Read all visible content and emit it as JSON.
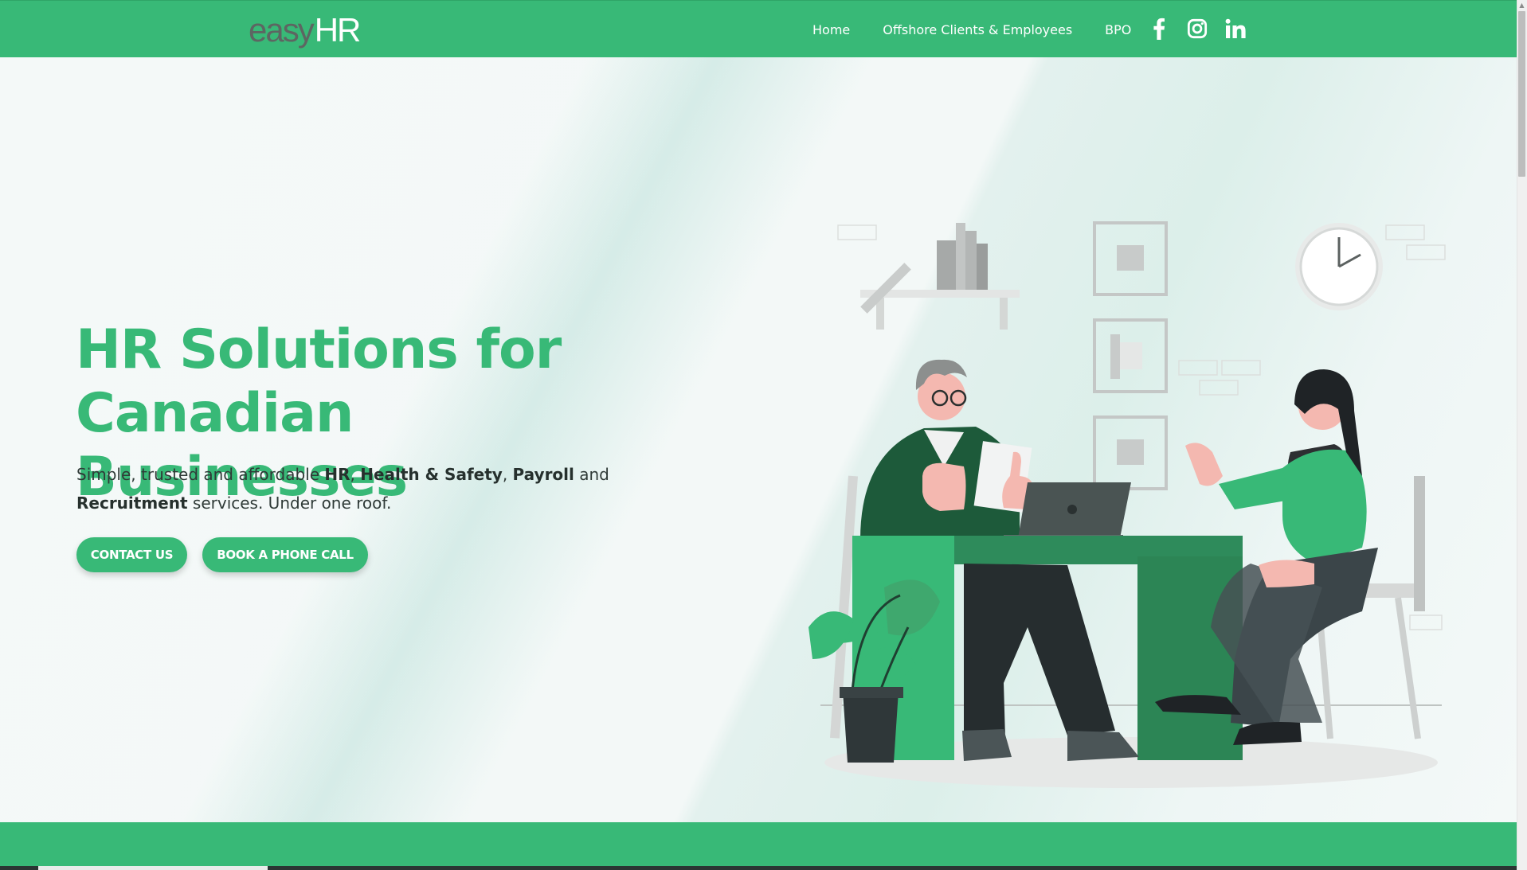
{
  "header": {
    "logo": {
      "part1": "easy",
      "part2": "HR"
    },
    "nav": [
      {
        "label": "Home"
      },
      {
        "label": "Offshore Clients & Employees"
      },
      {
        "label": "BPO"
      }
    ],
    "social": [
      {
        "icon": "facebook-icon"
      },
      {
        "icon": "instagram-icon"
      },
      {
        "icon": "linkedin-icon"
      }
    ]
  },
  "hero": {
    "headline_line1": "HR Solutions for",
    "headline_line2": "Canadian Businesses",
    "subtitle": {
      "intro": "Simple, trusted and affordable ",
      "hr": "HR",
      "sep1": ", ",
      "hs": "Health & Safety",
      "sep2": ", ",
      "payroll": "Payroll",
      "and": " and ",
      "recruitment": "Recruitment",
      "outro": " services. Under one roof."
    },
    "buttons": {
      "contact": "CONTACT US",
      "book": "BOOK A PHONE CALL"
    },
    "illustration_icon": "office-meeting-illustration"
  },
  "colors": {
    "brand_green": "#38b977",
    "dark_green": "#1f6b45",
    "text_dark": "#2f3a37",
    "logo_gray": "#5d6662"
  }
}
